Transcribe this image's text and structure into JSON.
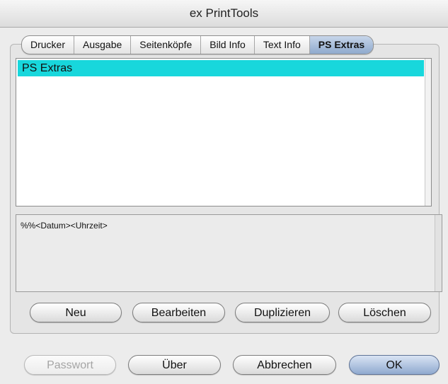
{
  "window": {
    "title": "ex PrintTools"
  },
  "tabs": [
    {
      "label": "Drucker"
    },
    {
      "label": "Ausgabe"
    },
    {
      "label": "Seitenköpfe"
    },
    {
      "label": "Bild Info"
    },
    {
      "label": "Text Info"
    },
    {
      "label": "PS Extras",
      "active": true
    }
  ],
  "list": {
    "items": [
      {
        "label": "PS Extras",
        "selected": true
      }
    ]
  },
  "editor": {
    "text": "%%<Datum><Uhrzeit>"
  },
  "list_buttons": {
    "new": "Neu",
    "edit": "Bearbeiten",
    "duplicate": "Duplizieren",
    "delete": "Löschen"
  },
  "dialog_buttons": {
    "password": "Passwort",
    "about": "Über",
    "cancel": "Abbrechen",
    "ok": "OK"
  },
  "colors": {
    "selection": "#18d7dc",
    "default_button": "#8fa9cf"
  }
}
